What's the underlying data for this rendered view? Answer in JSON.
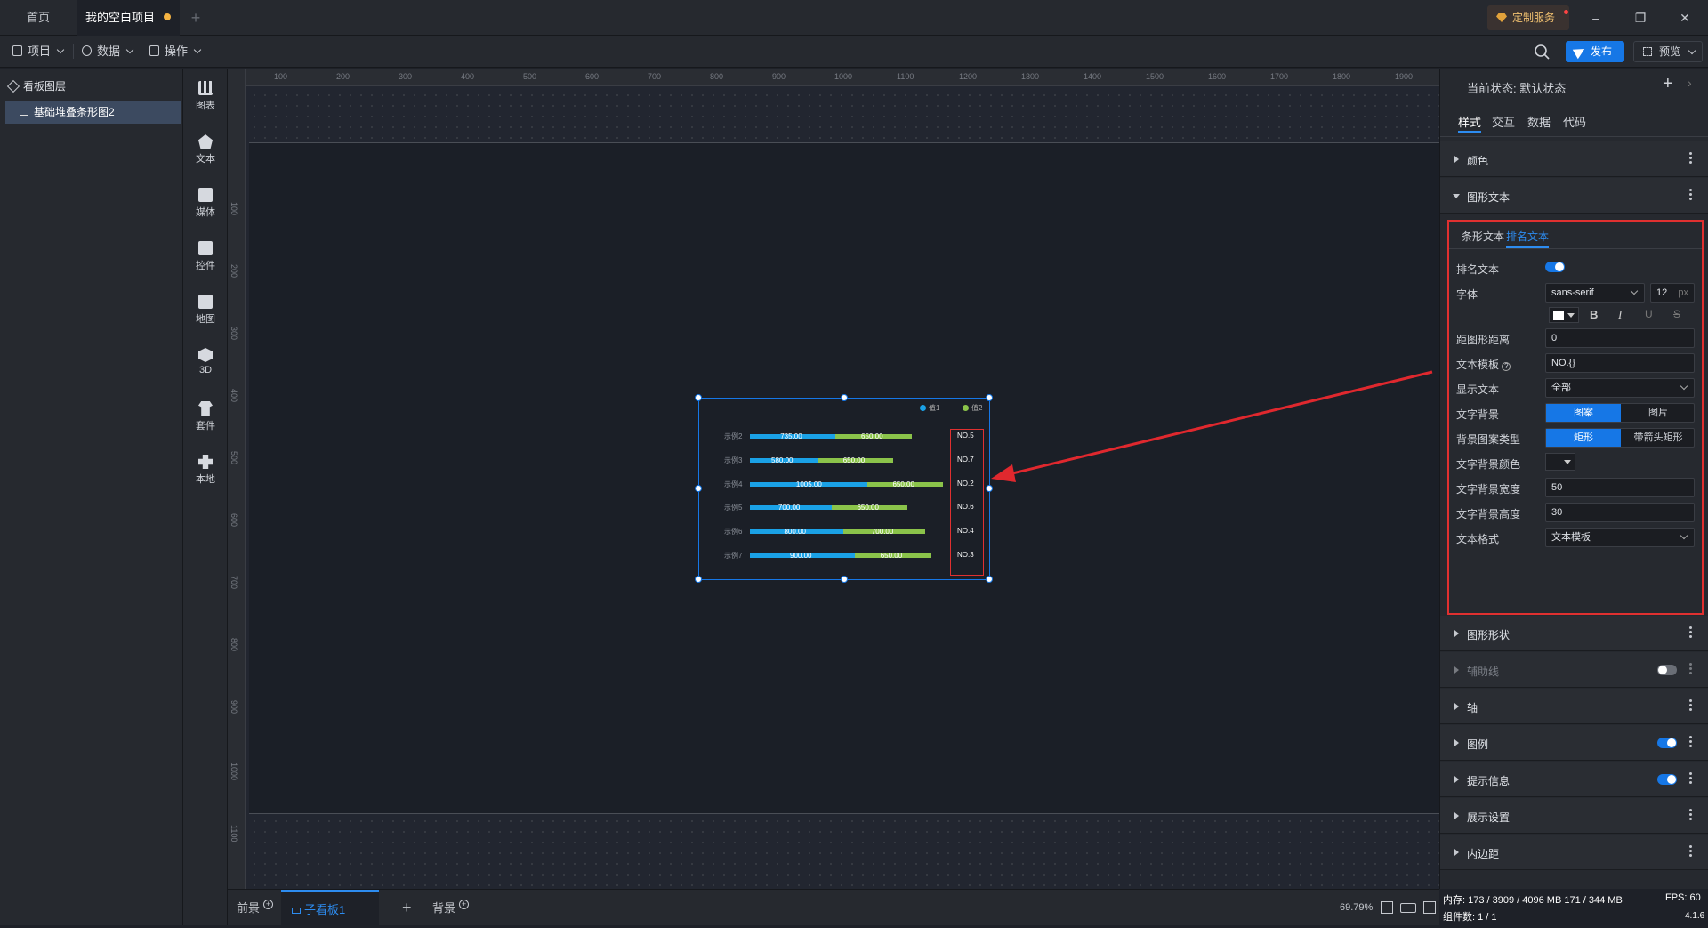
{
  "titlebar": {
    "tabs": [
      "首页",
      "我的空白项目"
    ],
    "custom_service": "定制服务"
  },
  "toolbar": {
    "menus": [
      "项目",
      "数据",
      "操作"
    ],
    "publish": "发布",
    "preview": "预览"
  },
  "layers": {
    "title": "看板图层",
    "items": [
      "基础堆叠条形图2"
    ]
  },
  "components": [
    "图表",
    "文本",
    "媒体",
    "控件",
    "地图",
    "3D",
    "套件",
    "本地"
  ],
  "ruler": {
    "h": [
      "100",
      "200",
      "300",
      "400",
      "500",
      "600",
      "700",
      "800",
      "900",
      "1000",
      "1100",
      "1200",
      "1300",
      "1400",
      "1500",
      "1600",
      "1700",
      "1800",
      "1900"
    ],
    "v": [
      "100",
      "200",
      "300",
      "400",
      "500",
      "600",
      "700",
      "800",
      "900",
      "1000",
      "1100"
    ]
  },
  "chart_data": {
    "type": "bar",
    "orientation": "horizontal",
    "stacked": true,
    "categories": [
      "示例2",
      "示例3",
      "示例4",
      "示例5",
      "示例6",
      "示例7"
    ],
    "series": [
      {
        "name": "值1",
        "color": "#1aa1e6",
        "values": [
          735,
          580,
          1005,
          700,
          800,
          900
        ]
      },
      {
        "name": "值2",
        "color": "#8bc34a",
        "values": [
          650,
          650,
          650,
          650,
          700,
          650
        ]
      }
    ],
    "value_labels": [
      [
        "735.00",
        "650.00"
      ],
      [
        "580.00",
        "650.00"
      ],
      [
        "1005.00",
        "650.00"
      ],
      [
        "700.00",
        "650.00"
      ],
      [
        "800.00",
        "700.00"
      ],
      [
        "900.00",
        "650.00"
      ]
    ],
    "ranks": [
      "NO.5",
      "NO.7",
      "NO.2",
      "NO.6",
      "NO.4",
      "NO.3"
    ],
    "legend": [
      "值1",
      "值2"
    ],
    "legend_position": "top-right",
    "xlim": [
      0,
      1700
    ]
  },
  "bottom": {
    "tabs": [
      "前景",
      "子看板1",
      "背景"
    ],
    "zoom": "69.79%"
  },
  "rpanel": {
    "state_label": "当前状态:",
    "state_value": "默认状态",
    "tabs": [
      "样式",
      "交互",
      "数据",
      "代码"
    ],
    "sections": {
      "color": "颜色",
      "shape_text": "图形文本",
      "shape": "图形形状",
      "guide": "辅助线",
      "axis": "轴",
      "legend": "图例",
      "tooltip": "提示信息",
      "display": "展示设置",
      "padding": "内边距"
    },
    "rank_text": {
      "subtabs": [
        "条形文本",
        "排名文本"
      ],
      "labels": {
        "enable": "排名文本",
        "font": "字体",
        "distance": "距图形距离",
        "template": "文本模板",
        "show": "显示文本",
        "bg": "文字背景",
        "bg_type": "背景图案类型",
        "bg_color": "文字背景颜色",
        "bg_width": "文字背景宽度",
        "bg_height": "文字背景高度",
        "format": "文本格式"
      },
      "font_family": "sans-serif",
      "font_size": "12",
      "font_unit": "px",
      "distance": "0",
      "template": "NO.{}",
      "show": "全部",
      "bg_options": [
        "图案",
        "图片"
      ],
      "bg_type_options": [
        "矩形",
        "带箭头矩形"
      ],
      "bg_width": "50",
      "bg_height": "30",
      "format": "文本模板"
    }
  },
  "status": {
    "memory": "内存: 173 / 3909 / 4096 MB  171 / 344 MB",
    "components": "组件数: 1 / 1",
    "fps": "FPS: 60",
    "version": "4.1.6"
  }
}
